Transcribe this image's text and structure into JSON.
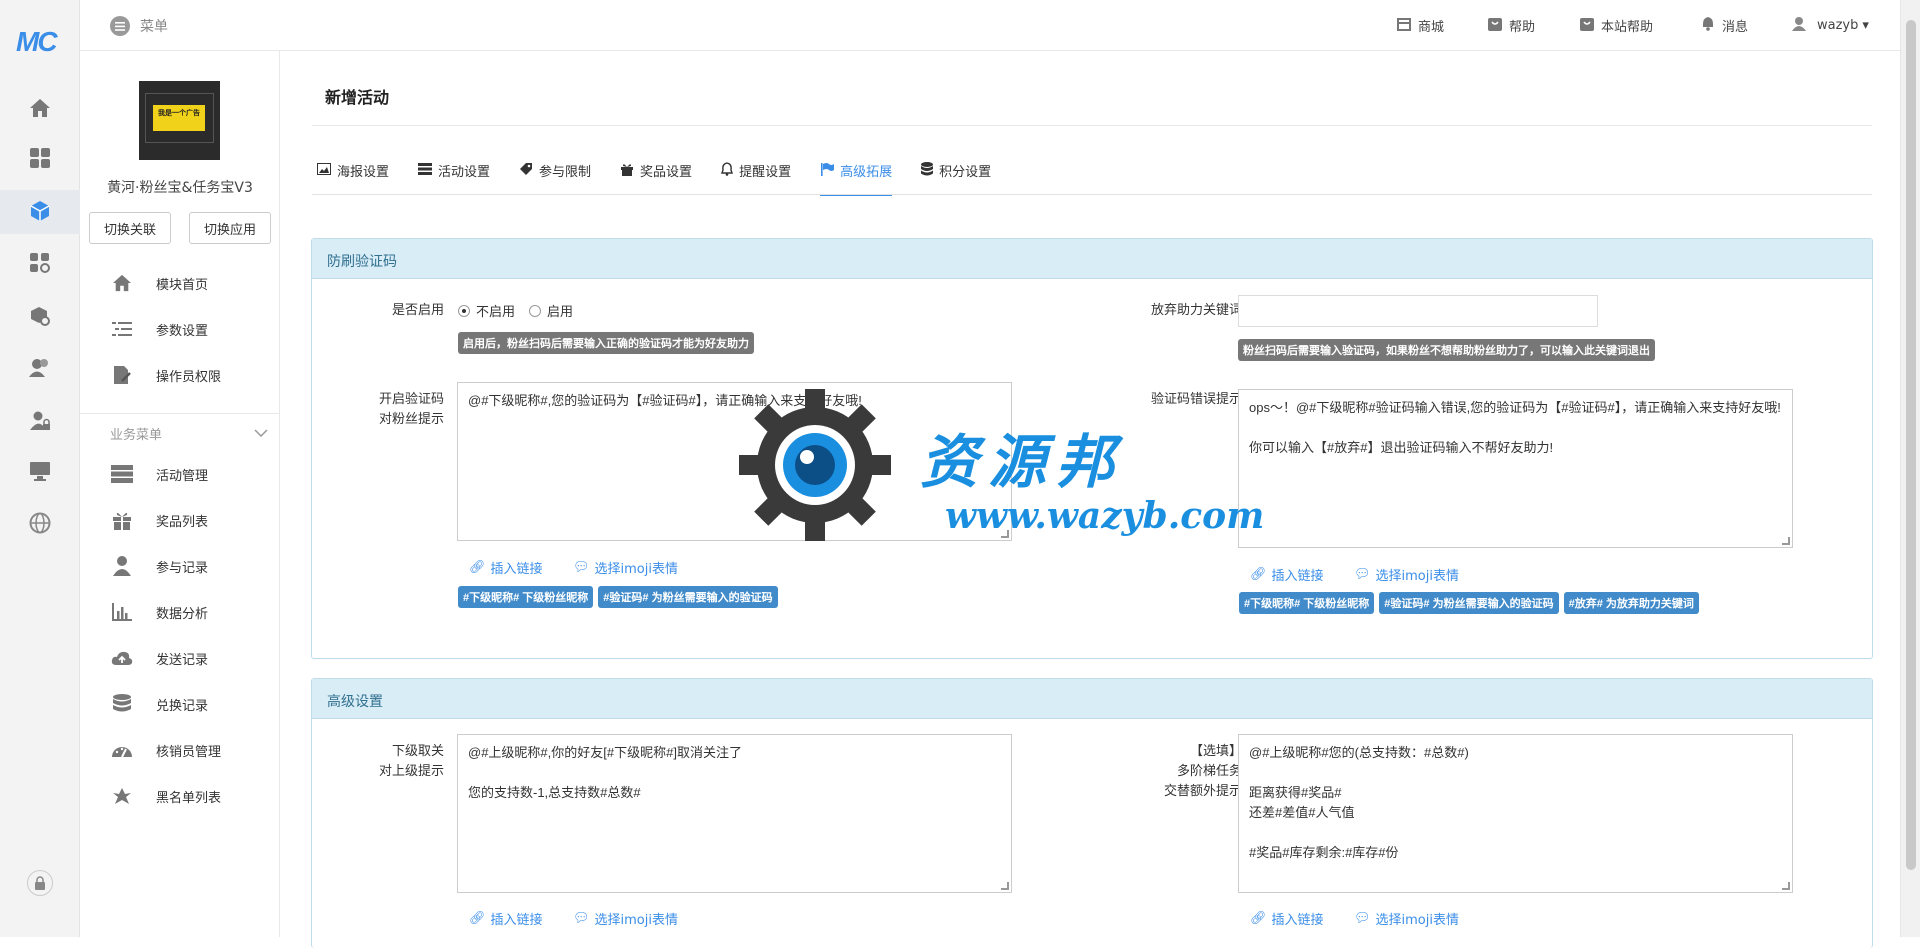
{
  "brand": {
    "logo_text": "MC"
  },
  "topbar": {
    "menu_label": "菜单",
    "links": [
      {
        "label": "商城",
        "icon": "shop-icon"
      },
      {
        "label": "帮助",
        "icon": "help-icon"
      },
      {
        "label": "本站帮助",
        "icon": "site-help-icon"
      },
      {
        "label": "消息",
        "icon": "bell-icon"
      },
      {
        "label": "wazyb",
        "icon": "user-icon"
      }
    ]
  },
  "app": {
    "thumb_text": "我是一个广告",
    "name": "黄河·粉丝宝&任务宝V3",
    "switch_link": "切换关联",
    "switch_app": "切换应用"
  },
  "sidebar": {
    "items": [
      {
        "label": "模块首页",
        "icon": "home-icon"
      },
      {
        "label": "参数设置",
        "icon": "list-settings-icon"
      },
      {
        "label": "操作员权限",
        "icon": "doc-edit-icon"
      }
    ],
    "group_label": "业务菜单",
    "group_items": [
      {
        "label": "活动管理",
        "icon": "server-icon"
      },
      {
        "label": "奖品列表",
        "icon": "gift-icon"
      },
      {
        "label": "参与记录",
        "icon": "person-icon"
      },
      {
        "label": "数据分析",
        "icon": "bar-chart-icon"
      },
      {
        "label": "发送记录",
        "icon": "cloud-upload-icon"
      },
      {
        "label": "兑换记录",
        "icon": "database-icon"
      },
      {
        "label": "核销员管理",
        "icon": "dashboard-icon"
      },
      {
        "label": "黑名单列表",
        "icon": "bug-icon"
      }
    ]
  },
  "page": {
    "title": "新增活动",
    "tabs": [
      {
        "label": "海报设置",
        "icon": "image-icon"
      },
      {
        "label": "活动设置",
        "icon": "tasks-icon"
      },
      {
        "label": "参与限制",
        "icon": "tag-icon"
      },
      {
        "label": "奖品设置",
        "icon": "gift-icon"
      },
      {
        "label": "提醒设置",
        "icon": "bell-icon"
      },
      {
        "label": "高级拓展",
        "icon": "flag-icon",
        "active": true
      },
      {
        "label": "积分设置",
        "icon": "database-icon"
      }
    ]
  },
  "captcha_panel": {
    "title": "防刷验证码",
    "enable_label": "是否启用",
    "radio_off": "不启用",
    "radio_on": "启用",
    "enable_help": "启用后，粉丝扫码后需要输入正确的验证码才能为好友助力",
    "giveup_label": "放弃助力关键词",
    "giveup_value": "",
    "giveup_help": "粉丝扫码后需要输入验证码，如果粉丝不想帮助粉丝助力了，可以输入此关键词退出",
    "prompt_label_1": "开启验证码",
    "prompt_label_2": "对粉丝提示",
    "prompt_text": "@#下级昵称#,您的验证码为【#验证码#】，请正确输入来支持好友哦!",
    "error_label": "验证码错误提示",
    "error_text": "ops～！@#下级昵称#验证码输入错误,您的验证码为【#验证码#】，请正确输入来支持好友哦!\n\n你可以输入【#放弃#】退出验证码输入不帮好友助力!",
    "insert_link": "插入链接",
    "select_emoji": "选择imoji表情",
    "chips_left": [
      "#下级昵称# 下级粉丝昵称",
      "#验证码# 为粉丝需要输入的验证码"
    ],
    "chips_right": [
      "#下级昵称# 下级粉丝昵称",
      "#验证码# 为粉丝需要输入的验证码",
      "#放弃# 为放弃助力关键词"
    ]
  },
  "advanced_panel": {
    "title": "高级设置",
    "unfollow_label_1": "下级取关",
    "unfollow_label_2": "对上级提示",
    "unfollow_text": "@#上级昵称#,你的好友[#下级昵称#]取消关注了\n\n您的支持数-1,总支持数#总数#",
    "multi_label_1": "【选填】",
    "multi_label_2": "多阶梯任务",
    "multi_label_3": "交替额外提示",
    "multi_text": "@#上级昵称#您的(总支持数：#总数#)\n\n距离获得#奖品#\n还差#差值#人气值\n\n#奖品#库存剩余:#库存#份",
    "insert_link": "插入链接",
    "select_emoji": "选择imoji表情"
  },
  "watermark": {
    "cn": "资源邦",
    "url": "www.wazyb.com"
  },
  "colors": {
    "accent": "#3b8ee8",
    "panel_head": "#d9edf7",
    "chip": "#428bca",
    "help_tag": "#777777"
  }
}
